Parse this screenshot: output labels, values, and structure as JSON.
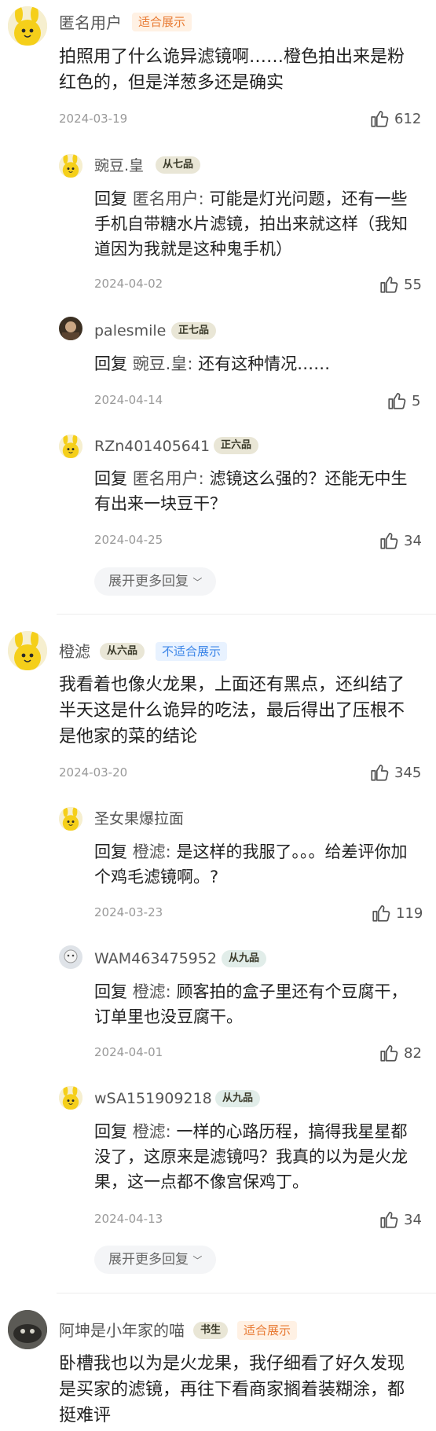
{
  "comments": [
    {
      "user": "匿名用户",
      "badge": "适合展示",
      "text": "拍照用了什么诡异滤镜啊……橙色拍出来是粉红色的，但是洋葱多还是确实",
      "date": "2024-03-19",
      "likes": "612",
      "replies": [
        {
          "user": "豌豆.皇",
          "rank": "从七品",
          "reply_word": "回复",
          "target": "匿名用户:",
          "text": "可能是灯光问题，还有一些手机自带糖水片滤镜，拍出来就这样（我知道因为我就是这种鬼手机）",
          "date": "2024-04-02",
          "likes": "55"
        },
        {
          "user": "palesmile",
          "rank": "正七品",
          "reply_word": "回复",
          "target": "豌豆.皇:",
          "text": "还有这种情况……",
          "date": "2024-04-14",
          "likes": "5"
        },
        {
          "user": "RZn401405641",
          "rank": "正六品",
          "reply_word": "回复",
          "target": "匿名用户:",
          "text": "滤镜这么强的？还能无中生有出来一块豆干？",
          "date": "2024-04-25",
          "likes": "34"
        }
      ],
      "more": "展开更多回复"
    },
    {
      "user": "橙滤",
      "rank": "从六品",
      "badge": "不适合展示",
      "text": "我看着也像火龙果，上面还有黑点，还纠结了半天这是什么诡异的吃法，最后得出了压根不是他家的菜的结论",
      "date": "2024-03-20",
      "likes": "345",
      "replies": [
        {
          "user": "圣女果爆拉面",
          "reply_word": "回复",
          "target": "橙滤:",
          "text": "是这样的我服了。。。给差评你加个鸡毛滤镜啊。?",
          "date": "2024-03-23",
          "likes": "119"
        },
        {
          "user": "WAM463475952",
          "rank": "从九品",
          "reply_word": "回复",
          "target": "橙滤:",
          "text": "顾客拍的盒子里还有个豆腐干，订单里也没豆腐干。",
          "date": "2024-04-01",
          "likes": "82"
        },
        {
          "user": "wSA151909218",
          "rank": "从九品",
          "reply_word": "回复",
          "target": "橙滤:",
          "text": "一样的心路历程，搞得我星星都没了，这原来是滤镜吗？我真的以为是火龙果，这一点都不像宫保鸡丁。",
          "date": "2024-04-13",
          "likes": "34"
        }
      ],
      "more": "展开更多回复"
    },
    {
      "user": "阿坤是小年家的喵",
      "rank": "书生",
      "badge": "适合展示",
      "text": "卧槽我也以为是火龙果，我仔细看了好久发现是买家的滤镜，再往下看商家搁着装糊涂，都挺难评"
    }
  ],
  "colors": {
    "orange_badge": "#e87a33",
    "blue_badge": "#3d86e8",
    "rank_badge_bg": "#e9e6d6"
  },
  "icons": {
    "like": "thumbs-up-icon",
    "expand": "chevron-down-icon",
    "avatar_default": "yellow-mascot-avatar"
  }
}
